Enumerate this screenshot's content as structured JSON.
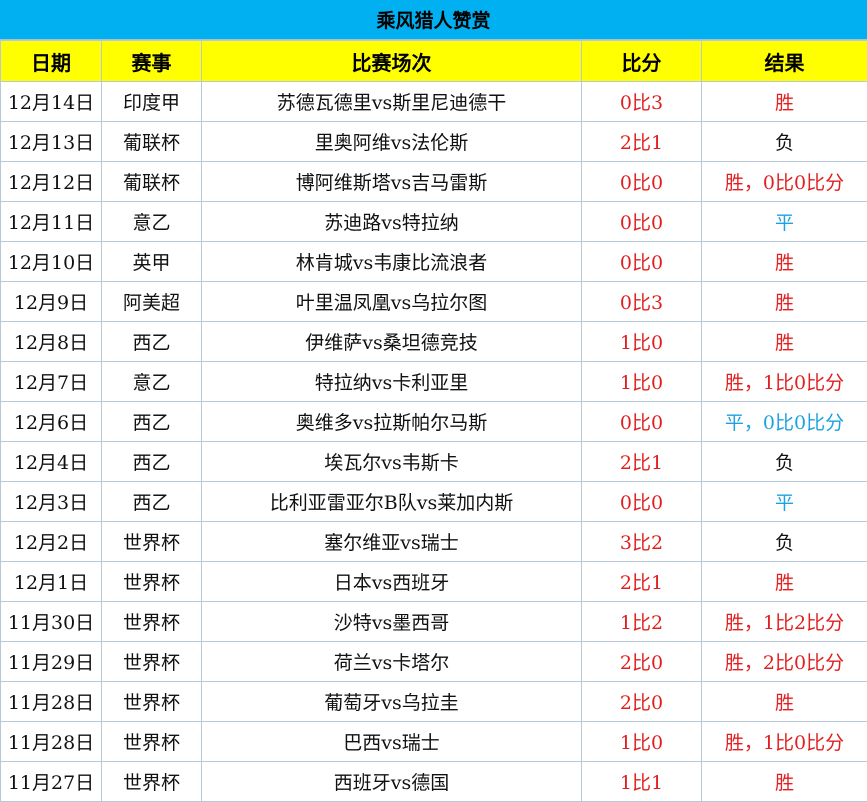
{
  "title": "乘风猎人赞赏",
  "headers": [
    "日期",
    "赛事",
    "比赛场次",
    "比分",
    "结果"
  ],
  "colors": {
    "title_bg": "#00b0f0",
    "header_bg": "#ffff00",
    "win": "#e02020",
    "draw": "#1ca2e0",
    "lose": "#111111"
  },
  "rows": [
    {
      "date": "12月14日",
      "league": "印度甲",
      "match": "苏德瓦德里vs斯里尼迪德干",
      "score": "0比3",
      "result": "胜",
      "result_type": "win"
    },
    {
      "date": "12月13日",
      "league": "葡联杯",
      "match": "里奥阿维vs法伦斯",
      "score": "2比1",
      "result": "负",
      "result_type": "lose"
    },
    {
      "date": "12月12日",
      "league": "葡联杯",
      "match": "博阿维斯塔vs吉马雷斯",
      "score": "0比0",
      "result": "胜，0比0比分",
      "result_type": "win"
    },
    {
      "date": "12月11日",
      "league": "意乙",
      "match": "苏迪路vs特拉纳",
      "score": "0比0",
      "result": "平",
      "result_type": "draw"
    },
    {
      "date": "12月10日",
      "league": "英甲",
      "match": "林肯城vs韦康比流浪者",
      "score": "0比0",
      "result": "胜",
      "result_type": "win"
    },
    {
      "date": "12月9日",
      "league": "阿美超",
      "match": "叶里温凤凰vs乌拉尔图",
      "score": "0比3",
      "result": "胜",
      "result_type": "win"
    },
    {
      "date": "12月8日",
      "league": "西乙",
      "match": "伊维萨vs桑坦德竞技",
      "score": "1比0",
      "result": "胜",
      "result_type": "win"
    },
    {
      "date": "12月7日",
      "league": "意乙",
      "match": "特拉纳vs卡利亚里",
      "score": "1比0",
      "result": "胜，1比0比分",
      "result_type": "win"
    },
    {
      "date": "12月6日",
      "league": "西乙",
      "match": "奥维多vs拉斯帕尔马斯",
      "score": "0比0",
      "result": "平，0比0比分",
      "result_type": "draw"
    },
    {
      "date": "12月4日",
      "league": "西乙",
      "match": "埃瓦尔vs韦斯卡",
      "score": "2比1",
      "result": "负",
      "result_type": "lose"
    },
    {
      "date": "12月3日",
      "league": "西乙",
      "match": "比利亚雷亚尔B队vs莱加内斯",
      "score": "0比0",
      "result": "平",
      "result_type": "draw"
    },
    {
      "date": "12月2日",
      "league": "世界杯",
      "match": "塞尔维亚vs瑞士",
      "score": "3比2",
      "result": "负",
      "result_type": "lose"
    },
    {
      "date": "12月1日",
      "league": "世界杯",
      "match": "日本vs西班牙",
      "score": "2比1",
      "result": "胜",
      "result_type": "win"
    },
    {
      "date": "11月30日",
      "league": "世界杯",
      "match": "沙特vs墨西哥",
      "score": "1比2",
      "result": "胜，1比2比分",
      "result_type": "win"
    },
    {
      "date": "11月29日",
      "league": "世界杯",
      "match": "荷兰vs卡塔尔",
      "score": "2比0",
      "result": "胜，2比0比分",
      "result_type": "win"
    },
    {
      "date": "11月28日",
      "league": "世界杯",
      "match": "葡萄牙vs乌拉圭",
      "score": "2比0",
      "result": "胜",
      "result_type": "win"
    },
    {
      "date": "11月28日",
      "league": "世界杯",
      "match": "巴西vs瑞士",
      "score": "1比0",
      "result": "胜，1比0比分",
      "result_type": "win"
    },
    {
      "date": "11月27日",
      "league": "世界杯",
      "match": "西班牙vs德国",
      "score": "1比1",
      "result": "胜",
      "result_type": "win"
    }
  ]
}
